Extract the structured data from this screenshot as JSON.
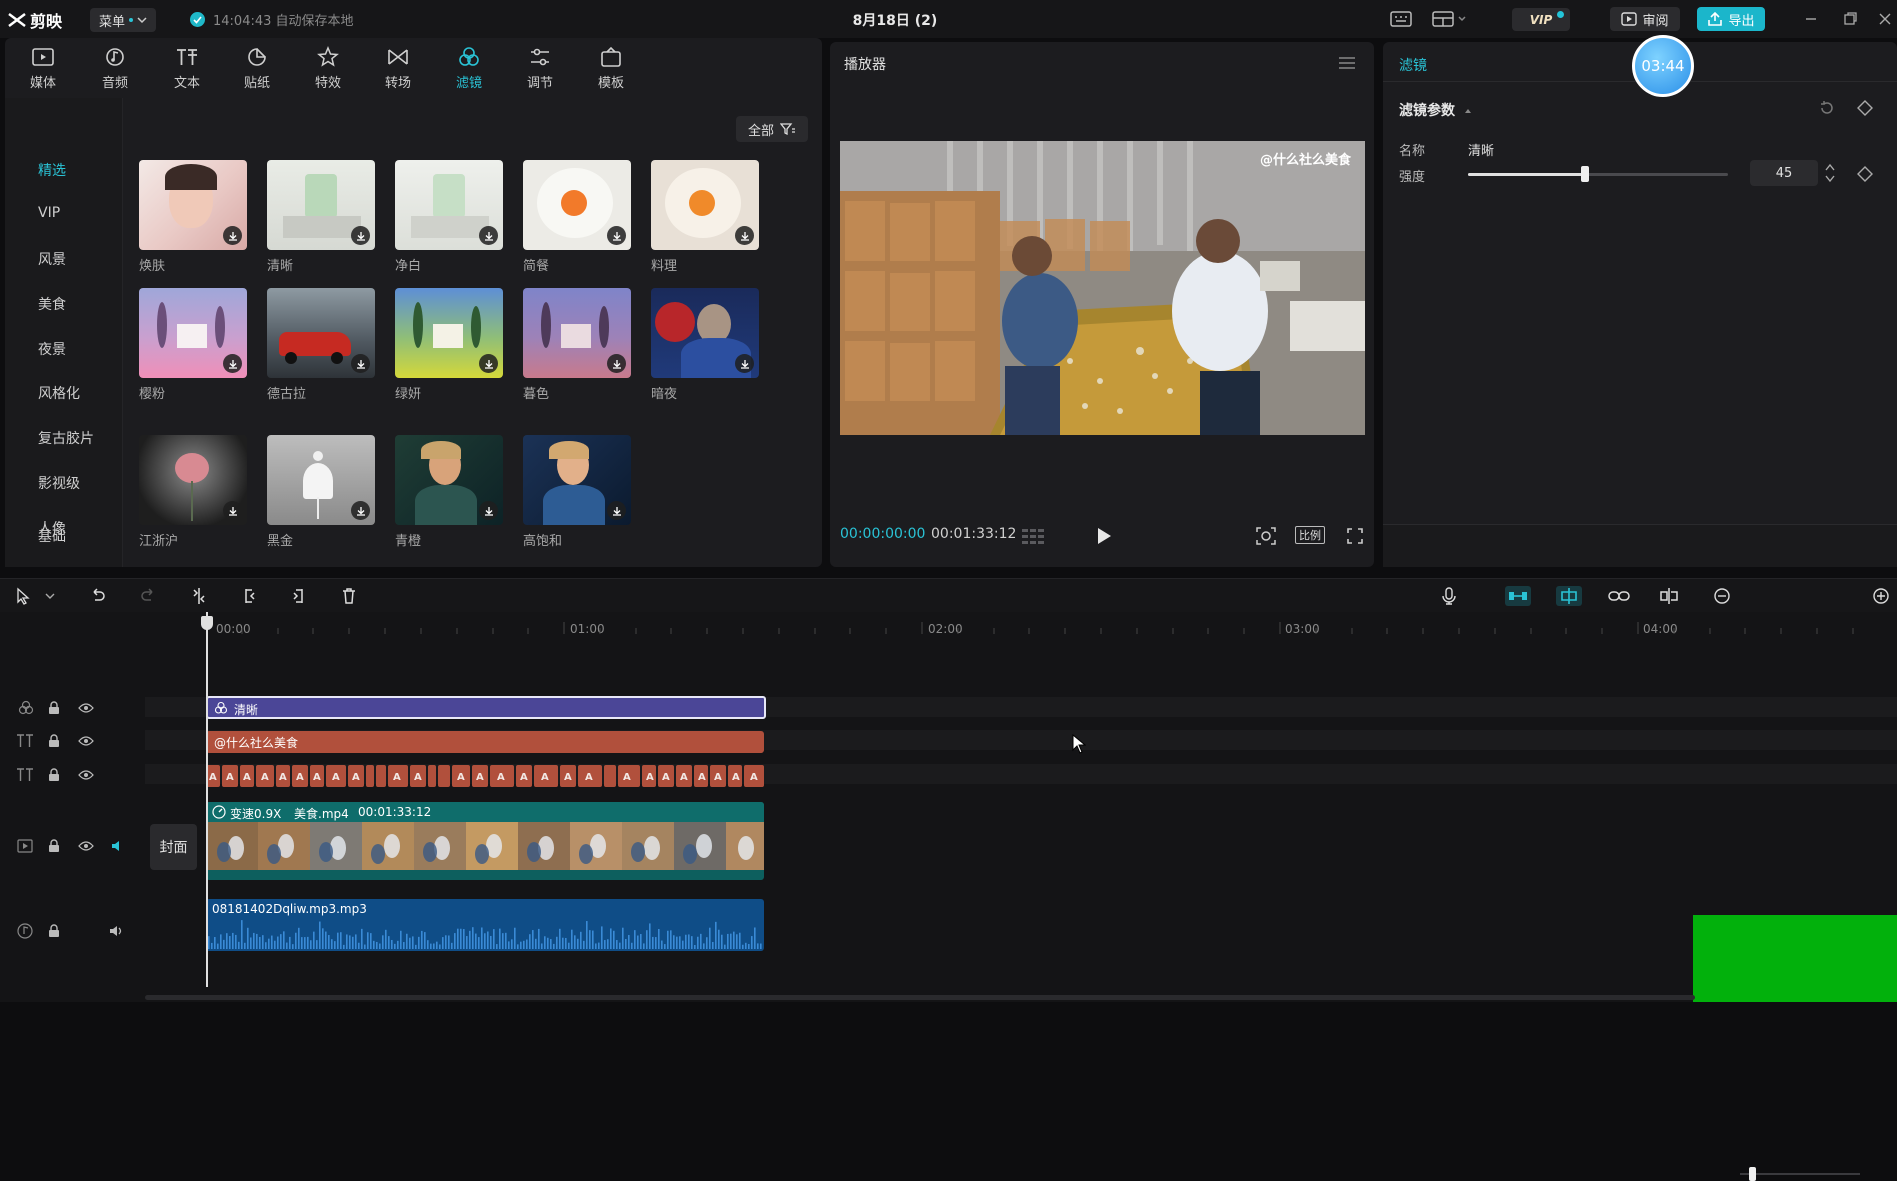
{
  "app": {
    "logo": "剪映",
    "menu_label": "菜单",
    "save_status": "14:04:43 自动保存本地",
    "project_title": "8月18日 (2)",
    "vip_label": "VIP",
    "review_label": "审阅",
    "export_label": "导出",
    "colors": {
      "accent": "#2ac3d6",
      "export": "#1bb6cb",
      "bg": "#0d0d0f"
    }
  },
  "media_tabs": [
    {
      "label": "媒体",
      "icon": "media-icon"
    },
    {
      "label": "音频",
      "icon": "audio-icon"
    },
    {
      "label": "文本",
      "icon": "text-icon"
    },
    {
      "label": "贴纸",
      "icon": "sticker-icon"
    },
    {
      "label": "特效",
      "icon": "effects-icon"
    },
    {
      "label": "转场",
      "icon": "transition-icon"
    },
    {
      "label": "滤镜",
      "icon": "filter-icon"
    },
    {
      "label": "调节",
      "icon": "adjust-icon"
    },
    {
      "label": "模板",
      "icon": "template-icon"
    }
  ],
  "filter_categories": [
    "精选",
    "VIP",
    "风景",
    "美食",
    "夜景",
    "风格化",
    "复古胶片",
    "影视级",
    "人像",
    "基础"
  ],
  "filter_all_label": "全部",
  "filters": [
    "焕肤",
    "清晰",
    "净白",
    "简餐",
    "料理",
    "樱粉",
    "德古拉",
    "绿妍",
    "暮色",
    "暗夜",
    "江浙沪",
    "黑金",
    "青橙",
    "高饱和"
  ],
  "player": {
    "title": "播放器",
    "watermark": "@什么社么美食",
    "current_time": "00:00:00:00",
    "total_time": "00:01:33:12",
    "ratio_label": "比例"
  },
  "props": {
    "title": "滤镜",
    "timer": "03:44",
    "section": "滤镜参数",
    "name_label": "名称",
    "name_value": "清晰",
    "strength_label": "强度",
    "strength_value": "45",
    "strength_fraction": 0.45
  },
  "timeline": {
    "ruler": [
      "00:00",
      "01:00",
      "02:00",
      "03:00",
      "04:00"
    ],
    "filter_clip": "清晰",
    "text_clip": "@什么社么美食",
    "video_clip": {
      "speed": "变速0.9X",
      "file": "美食.mp4",
      "duration": "00:01:33:12"
    },
    "audio_clip": "08181402Dqliw.mp3.mp3",
    "cover_label": "封面"
  }
}
